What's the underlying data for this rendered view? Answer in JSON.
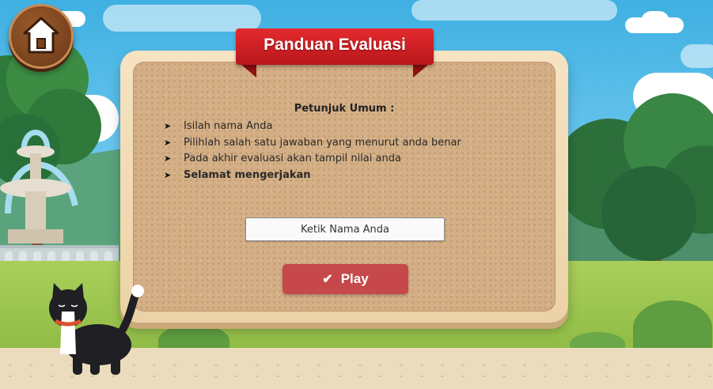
{
  "header": {
    "home_icon": "home-icon",
    "title": "Panduan Evaluasi"
  },
  "instructions": {
    "heading": "Petunjuk Umum :",
    "items": [
      "Isilah nama Anda",
      "Pilihlah salah satu jawaban yang menurut anda benar",
      "Pada akhir evaluasi akan tampil nilai anda",
      "Selamat mengerjakan"
    ],
    "bullet": "➤"
  },
  "form": {
    "name_placeholder": "Ketik Nama Anda",
    "play_label": "Play",
    "play_icon": "✔"
  },
  "colors": {
    "ribbon": "#d32025",
    "play_button": "#c6484a",
    "home_button": "#7a441e"
  }
}
